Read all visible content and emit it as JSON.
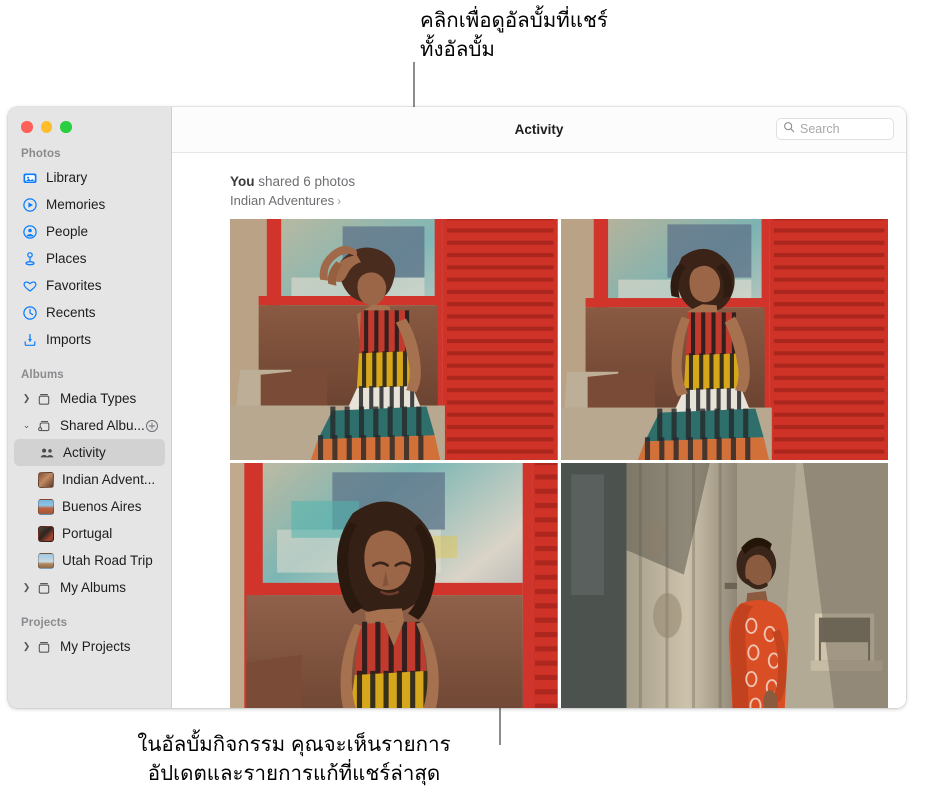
{
  "annotations": {
    "top": "คลิกเพื่อดูอัลบั้มที่แชร์\nทั้งอัลบั้ม",
    "bottom": "ในอัลบั้มกิจกรรม คุณจะเห็นรายการ\nอัปเดตและรายการแก้ที่แชร์ล่าสุด"
  },
  "window": {
    "title": "Activity",
    "traffic_lights": {
      "close": "close",
      "minimize": "minimize",
      "zoom": "zoom"
    }
  },
  "search": {
    "placeholder": "Search",
    "value": "",
    "icon": "search-icon"
  },
  "sidebar": {
    "sections": [
      {
        "title": "Photos",
        "items": [
          {
            "label": "Library",
            "icon": "photos-library-icon",
            "selected": false
          },
          {
            "label": "Memories",
            "icon": "memories-icon",
            "selected": false
          },
          {
            "label": "People",
            "icon": "people-icon",
            "selected": false
          },
          {
            "label": "Places",
            "icon": "places-pin-icon",
            "selected": false
          },
          {
            "label": "Favorites",
            "icon": "heart-icon",
            "selected": false
          },
          {
            "label": "Recents",
            "icon": "clock-icon",
            "selected": false
          },
          {
            "label": "Imports",
            "icon": "import-arrow-icon",
            "selected": false
          }
        ]
      },
      {
        "title": "Albums",
        "items": [
          {
            "label": "Media Types",
            "icon": "album-folder-icon",
            "disclosure": "collapsed",
            "selected": false
          },
          {
            "label": "Shared Albu...",
            "icon": "shared-album-icon",
            "disclosure": "expanded",
            "selected": false,
            "accessory": "add-shared-album-button"
          },
          {
            "label": "Activity",
            "icon": "activity-people-icon",
            "indent": true,
            "selected": true
          },
          {
            "label": "Indian Advent...",
            "icon": "album-thumbnail",
            "indent": true,
            "selected": false,
            "thumb_colors": [
              "#6e4a37",
              "#c08a63"
            ]
          },
          {
            "label": "Buenos Aires",
            "icon": "album-thumbnail",
            "indent": true,
            "selected": false,
            "thumb_colors": [
              "#6ea7cf",
              "#c3794f"
            ]
          },
          {
            "label": "Portugal",
            "icon": "album-thumbnail",
            "indent": true,
            "selected": false,
            "thumb_colors": [
              "#3a2a22",
              "#a8452f"
            ]
          },
          {
            "label": "Utah Road Trip",
            "icon": "album-thumbnail",
            "indent": true,
            "selected": false,
            "thumb_colors": [
              "#8fbcd8",
              "#b49070"
            ]
          },
          {
            "label": "My Albums",
            "icon": "album-folder-icon",
            "disclosure": "collapsed",
            "selected": false
          }
        ]
      },
      {
        "title": "Projects",
        "items": [
          {
            "label": "My Projects",
            "icon": "album-folder-icon",
            "disclosure": "collapsed",
            "selected": false
          }
        ]
      }
    ]
  },
  "activity": {
    "item": {
      "actor": "You",
      "action": " shared 6 photos",
      "album_name": "Indian Adventures",
      "chevron": "›"
    },
    "photos": [
      {
        "name": "woman-hand-on-head-red-shutter"
      },
      {
        "name": "woman-seated-red-shutter"
      },
      {
        "name": "woman-eyes-closed-closeup"
      },
      {
        "name": "man-orange-shirt-by-door"
      }
    ]
  },
  "colors": {
    "accent": "#0a7cff",
    "sidebar_bg": "#e5e5e5",
    "selected_row": "#d2d2d2",
    "title_text": "#1d1d1f",
    "secondary_text": "#6e6e73",
    "leader_line": "#8d8d8d"
  }
}
